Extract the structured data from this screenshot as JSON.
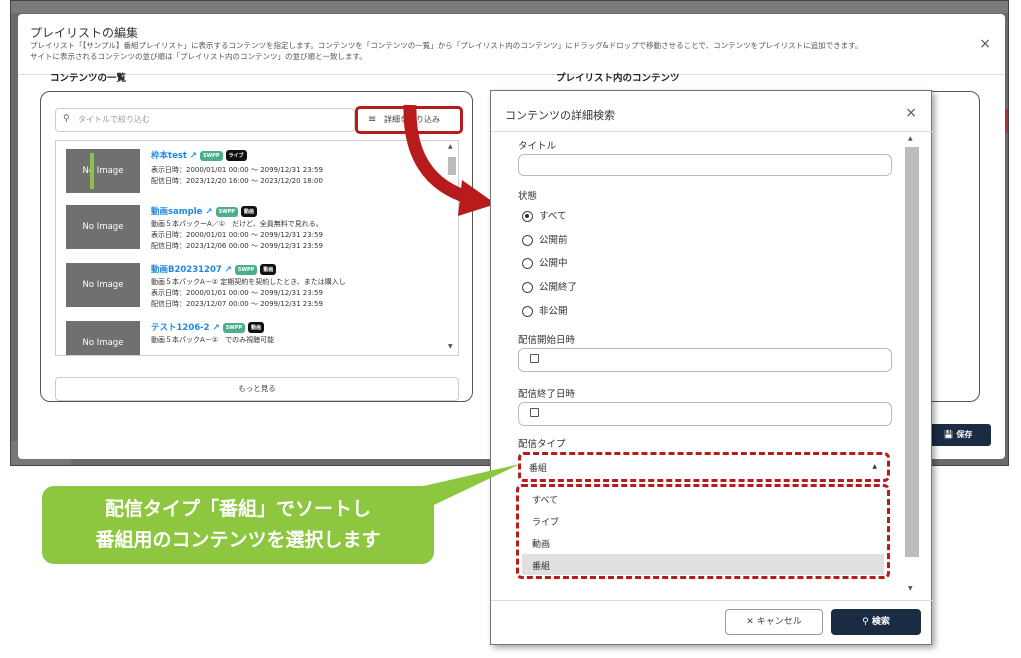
{
  "modal": {
    "title": "プレイリストの編集",
    "desc_line1": "プレイリスト「【サンプル】番組プレイリスト」に表示するコンテンツを指定します。コンテンツを「コンテンツの一覧」から「プレイリスト内のコンテンツ」にドラッグ&ドロップで移動させることで、コンテンツをプレイリストに追加できます。",
    "desc_line2": "サイトに表示されるコンテンツの並び順は「プレイリスト内のコンテンツ」の並び順と一致します。",
    "close": "×",
    "left_heading": "コンテンツの一覧",
    "right_heading": "プレイリスト内のコンテンツ",
    "search_placeholder": "タイトルで絞り込む",
    "filter_label": "詳細な絞り込み",
    "more_label": "もっと見る",
    "save_label": "保存"
  },
  "items": [
    {
      "thumb": "No Image",
      "title": "枠本test",
      "tags": [
        "SWPP",
        "ライブ"
      ],
      "lines": [
        "表示日時：2000/01/01 00:00 ～ 2099/12/31 23:59",
        "配信日時：2023/12/20 16:00 ～ 2023/12/20 18:00"
      ]
    },
    {
      "thumb": "No Image",
      "title": "動画sample",
      "tags": [
        "SWPP",
        "動画"
      ],
      "lines": [
        "動画５本パックーA／①　だけど、全員無料で見れる。",
        "表示日時：2000/01/01 00:00 ～ 2099/12/31 23:59",
        "配信日時：2023/12/06 00:00 ～ 2099/12/31 23:59"
      ]
    },
    {
      "thumb": "No Image",
      "title": "動画B20231207",
      "tags": [
        "SWPP",
        "動画"
      ],
      "lines": [
        "動画５本パックA－② 定期契約を契約したとき、または購入し",
        "表示日時：2000/01/01 00:00 ～ 2099/12/31 23:59",
        "配信日時：2023/12/07 00:00 ～ 2099/12/31 23:59"
      ]
    },
    {
      "thumb": "No Image",
      "title": "テスト1206-2",
      "tags": [
        "SWPP",
        "動画"
      ],
      "lines": [
        "動画５本パックA－②　でのみ視聴可能"
      ]
    }
  ],
  "dialog": {
    "title": "コンテンツの詳細検索",
    "close": "×",
    "title_label": "タイトル",
    "status_label": "状態",
    "status_options": [
      "すべて",
      "公開前",
      "公開中",
      "公開終了",
      "非公開"
    ],
    "status_selected": "すべて",
    "start_label": "配信開始日時",
    "end_label": "配信終了日時",
    "type_label": "配信タイプ",
    "type_selected": "番組",
    "type_options": [
      "すべて",
      "ライブ",
      "動画",
      "番組"
    ],
    "cancel_label": "キャンセル",
    "search_label": "検索"
  },
  "callout": {
    "line1": "配信タイプ「番組」でソートし",
    "line2": "番組用のコンテンツを選択します"
  },
  "colors": {
    "accent_red": "#b71b1b",
    "callout_green": "#8dc63f",
    "navy": "#1a2b44",
    "link_blue": "#1e88e5"
  }
}
